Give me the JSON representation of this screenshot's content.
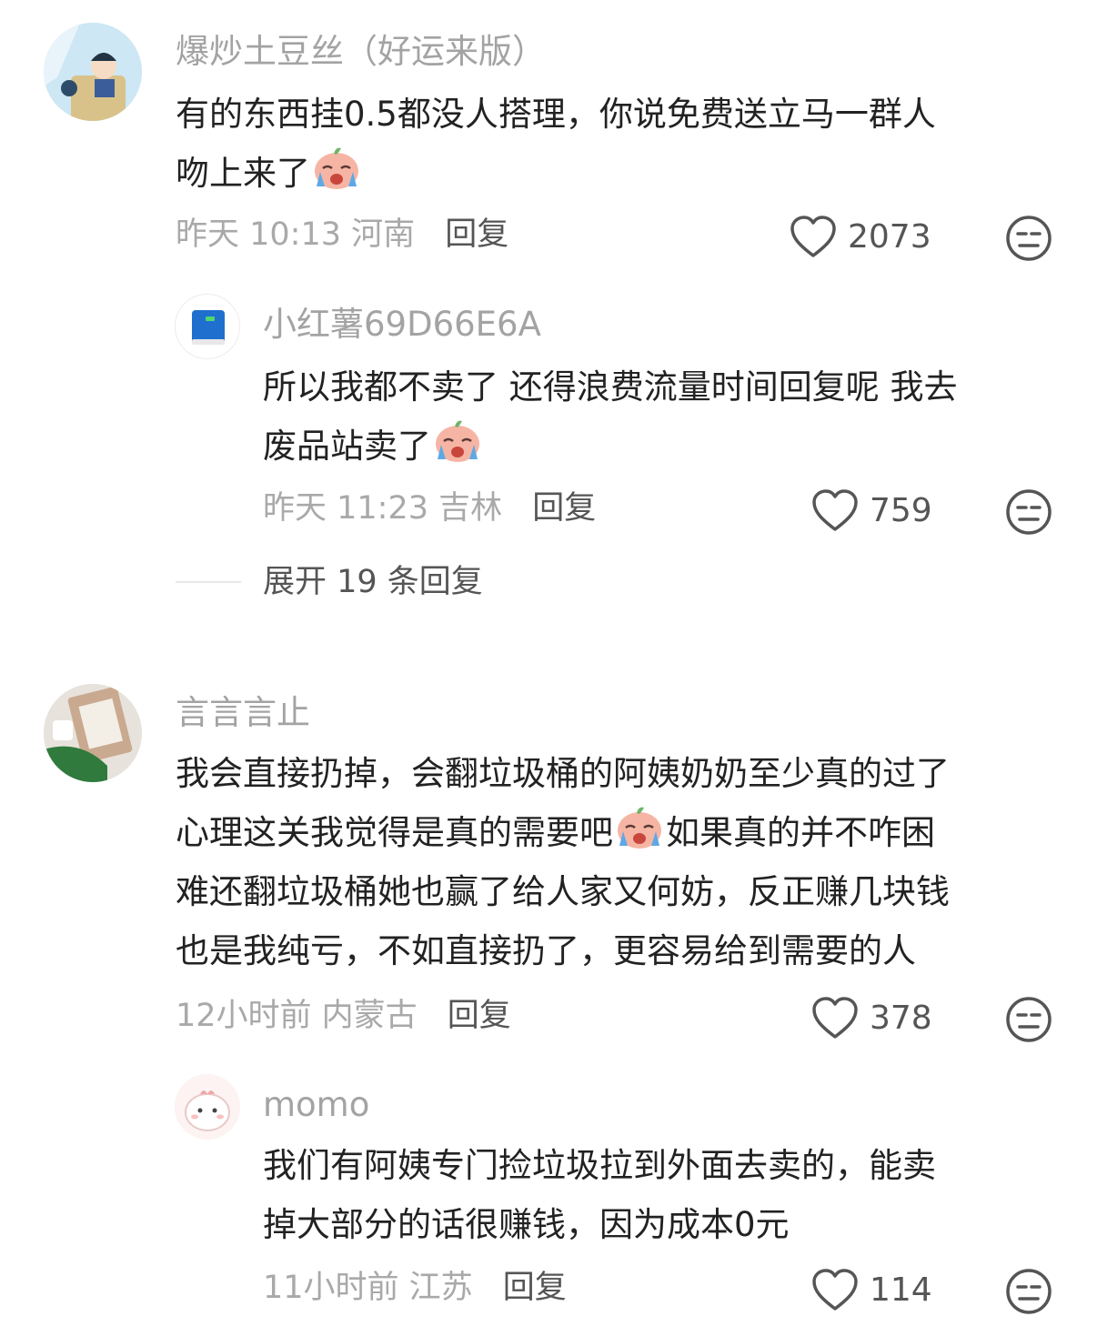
{
  "comments": [
    {
      "username": "爆炒土豆丝（好运来版）",
      "lines": [
        {
          "pre": "有的东西挂0.5都没人搭理，你说免费送立马一群人",
          "post": ""
        },
        {
          "pre": "吻上来了",
          "post": "",
          "emoji": "crying-face-emoji"
        }
      ],
      "time_location": "昨天 10:13 河南",
      "reply_label": "回复",
      "likes": "2073",
      "reply": {
        "username": "小红薯69D66E6A",
        "lines": [
          {
            "pre": "所以我都不卖了 还得浪费流量时间回复呢 我去",
            "post": ""
          },
          {
            "pre": "废品站卖了",
            "post": "",
            "emoji": "crying-face-emoji"
          }
        ],
        "time_location": "昨天 11:23 吉林",
        "reply_label": "回复",
        "likes": "759"
      },
      "expand_label": "展开 19 条回复"
    },
    {
      "username": "言言言止",
      "lines": [
        {
          "pre": "我会直接扔掉，会翻垃圾桶的阿姨奶奶至少真的过了",
          "post": ""
        },
        {
          "pre": "心理这关我觉得是真的需要吧",
          "post": "如果真的并不咋困",
          "emoji": "crying-face-emoji"
        },
        {
          "pre": "难还翻垃圾桶她也赢了给人家又何妨，反正赚几块钱",
          "post": ""
        },
        {
          "pre": "也是我纯亏，不如直接扔了，更容易给到需要的人",
          "post": ""
        }
      ],
      "time_location": "12小时前 内蒙古",
      "reply_label": "回复",
      "likes": "378",
      "reply": {
        "username": "momo",
        "lines": [
          {
            "pre": "我们有阿姨专门捡垃圾拉到外面去卖的，能卖",
            "post": ""
          },
          {
            "pre": "掉大部分的话很赚钱，因为成本0元",
            "post": ""
          }
        ],
        "time_location": "11小时前 江苏",
        "reply_label": "回复",
        "likes": "114"
      }
    }
  ],
  "colors": {
    "text": "#222222",
    "muted": "#a9a9a9",
    "action": "#555555"
  }
}
